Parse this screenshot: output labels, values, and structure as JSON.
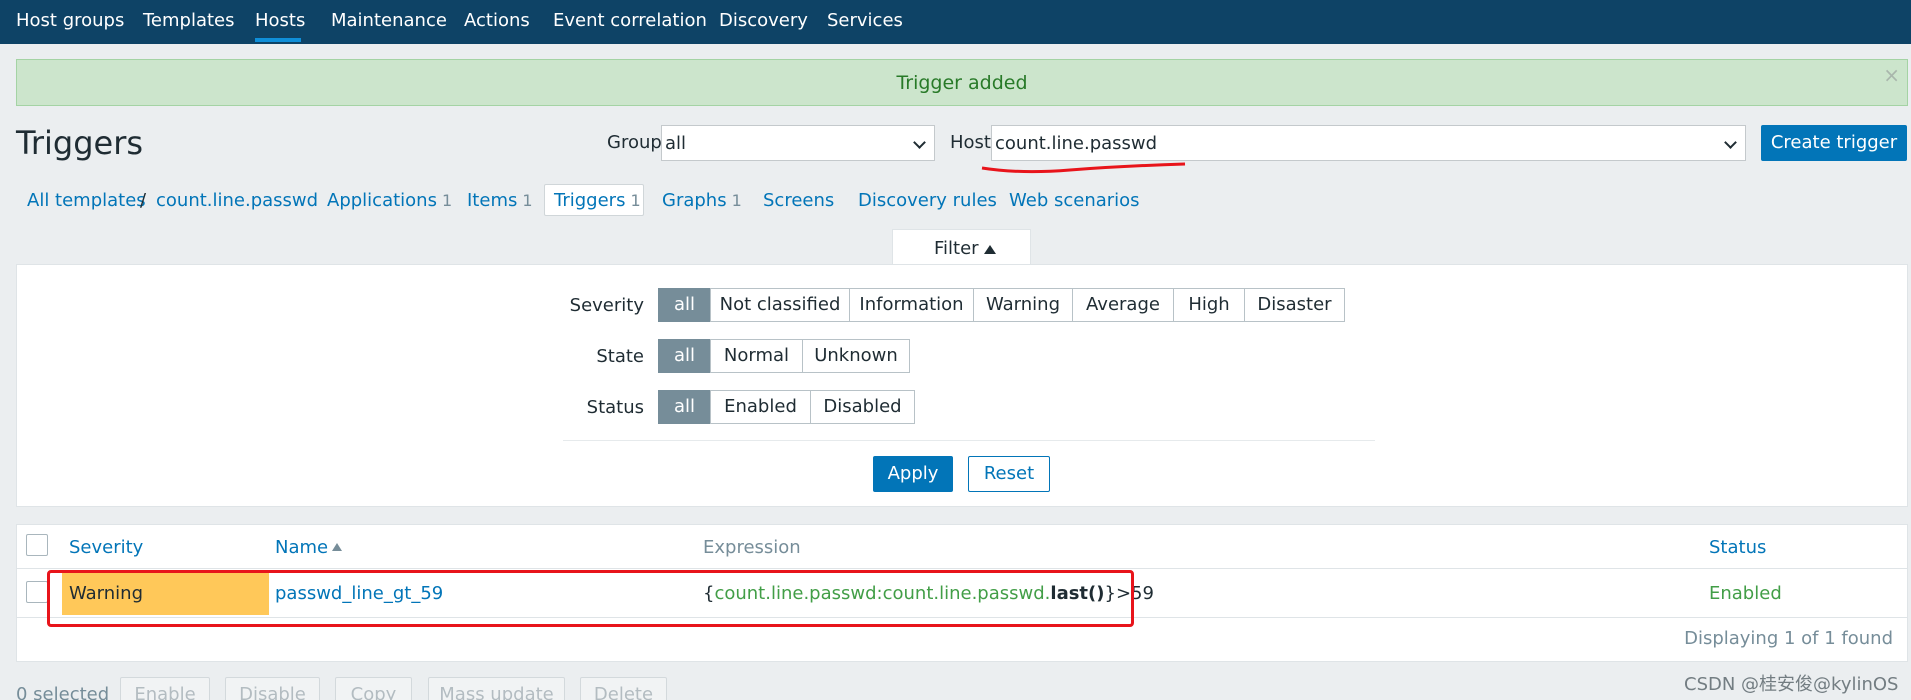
{
  "topnav": {
    "items": [
      "Host groups",
      "Templates",
      "Hosts",
      "Maintenance",
      "Actions",
      "Event correlation",
      "Discovery",
      "Services"
    ],
    "active_index": 2
  },
  "message": {
    "text": "Trigger added",
    "close": "×"
  },
  "header": {
    "title": "Triggers",
    "group_label": "Group",
    "group_value": "all",
    "host_label": "Host",
    "host_value": "count.line.passwd",
    "create_button": "Create trigger"
  },
  "breadcrumbs": {
    "all_templates": "All templates",
    "separator": "/",
    "template": "count.line.passwd",
    "tabs": [
      {
        "label": "Applications",
        "count": "1"
      },
      {
        "label": "Items",
        "count": "1"
      },
      {
        "label": "Triggers",
        "count": "1"
      },
      {
        "label": "Graphs",
        "count": "1"
      },
      {
        "label": "Screens",
        "count": ""
      },
      {
        "label": "Discovery rules",
        "count": ""
      },
      {
        "label": "Web scenarios",
        "count": ""
      }
    ],
    "active_tab": "Triggers"
  },
  "filter": {
    "tab_label": "Filter",
    "severity_label": "Severity",
    "severity_options": [
      "all",
      "Not classified",
      "Information",
      "Warning",
      "Average",
      "High",
      "Disaster"
    ],
    "state_label": "State",
    "state_options": [
      "all",
      "Normal",
      "Unknown"
    ],
    "status_label": "Status",
    "status_options": [
      "all",
      "Enabled",
      "Disabled"
    ],
    "selected": "all",
    "apply": "Apply",
    "reset": "Reset"
  },
  "table": {
    "columns": [
      "Severity",
      "Name",
      "Expression",
      "Status"
    ],
    "sorted_column": "Name",
    "rows": [
      {
        "severity": "Warning",
        "name": "passwd_line_gt_59",
        "expression_open": "{",
        "expression_host_item": "count.line.passwd:count.line.passwd",
        "expression_dot": ".",
        "expression_func": "last()",
        "expression_close": "}>59",
        "status": "Enabled"
      }
    ],
    "footer": "Displaying 1 of 1 found"
  },
  "bottom": {
    "selected_count": "0 selected",
    "buttons": [
      "Enable",
      "Disable",
      "Copy",
      "Mass update",
      "Delete"
    ]
  },
  "watermark": "CSDN @桂安俊@kylinOS",
  "colors": {
    "nav_bg": "#0e4366",
    "accent": "#0275b8",
    "warning": "#ffc859",
    "success_bg": "#cce5cc",
    "annotation_red": "#e8141b"
  }
}
